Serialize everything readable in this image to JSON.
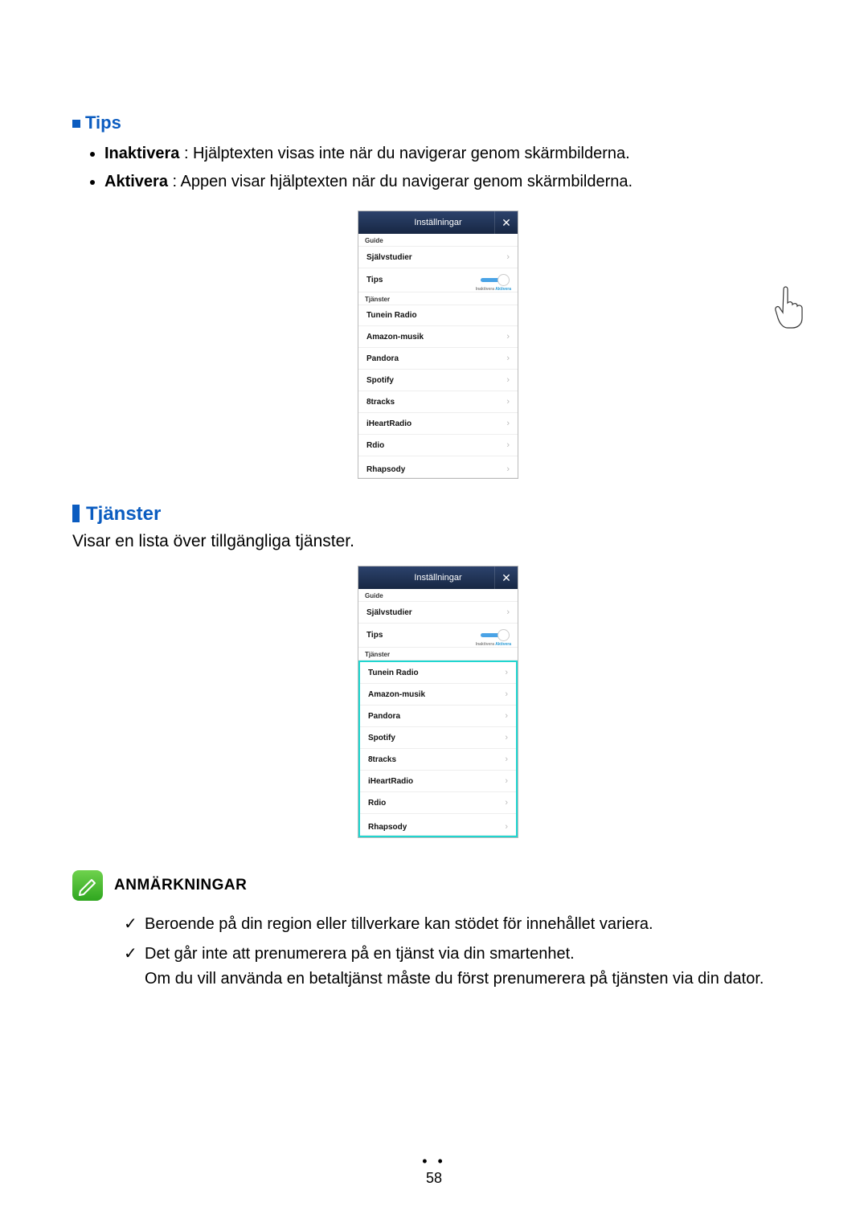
{
  "tips": {
    "heading": "Tips",
    "items": [
      {
        "bold": "Inaktivera",
        "rest": " : Hjälptexten visas inte när du navigerar genom skärmbilderna."
      },
      {
        "bold": "Aktivera",
        "rest": " : Appen visar hjälptexten när du navigerar genom skärmbilderna."
      }
    ]
  },
  "phone": {
    "title": "Inställningar",
    "close": "✕",
    "guide_label": "Guide",
    "self_study": "Självstudier",
    "tips": "Tips",
    "toggle_inactive": "Inaktivera",
    "toggle_active": "Aktivera",
    "services_label": "Tjänster",
    "services": [
      "Tunein Radio",
      "Amazon-musik",
      "Pandora",
      "Spotify",
      "8tracks",
      "iHeartRadio",
      "Rdio",
      "Rhapsody"
    ]
  },
  "services_section": {
    "heading": "Tjänster",
    "desc": "Visar en lista över tillgängliga tjänster."
  },
  "notes": {
    "heading": "ANMÄRKNINGAR",
    "items": [
      "Beroende på din region eller tillverkare kan stödet för innehållet variera.",
      "Det går inte att prenumerera på en tjänst via din smartenhet."
    ],
    "sub": "Om du vill använda en betaltjänst måste du först prenumerera på tjänsten via din dator."
  },
  "page": {
    "dots": "• •",
    "num": "58"
  }
}
